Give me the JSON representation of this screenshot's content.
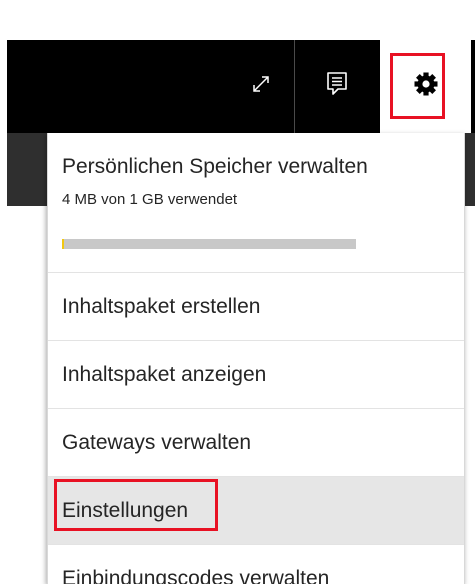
{
  "toolbar": {
    "icons": {
      "expand": "expand-diagonal-icon",
      "feedback": "feedback-comment-icon",
      "settings": "gear-icon"
    }
  },
  "storage": {
    "title": "Persönlichen Speicher verwalten",
    "usage_text": "4 MB von 1 GB verwendet",
    "used_fraction": 0.004
  },
  "menu": {
    "items": [
      {
        "label": "Inhaltspaket erstellen"
      },
      {
        "label": "Inhaltspaket anzeigen"
      },
      {
        "label": "Gateways verwalten"
      },
      {
        "label": "Einstellungen",
        "selected": true
      },
      {
        "label": "Einbindungscodes verwalten"
      }
    ]
  },
  "colors": {
    "toolbar_bg": "#000000",
    "highlight_box": "#e81123",
    "storage_fill": "#f2c811",
    "storage_track": "#c8c8c8",
    "selected_bg": "#e6e6e6"
  }
}
